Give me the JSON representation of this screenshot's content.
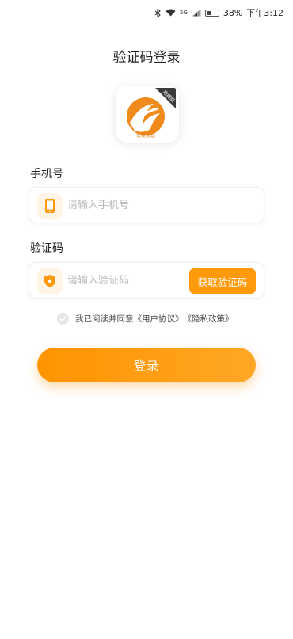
{
  "status_bar": {
    "battery": "38%",
    "time": "下午3:12",
    "network": "5G"
  },
  "page": {
    "title": "验证码登录"
  },
  "logo": {
    "badge_text": "跑腿版",
    "caption": "优易急送"
  },
  "phone": {
    "label": "手机号",
    "placeholder": "请输入手机号",
    "icon": "phone-icon"
  },
  "code": {
    "label": "验证码",
    "placeholder": "请输入验证码",
    "icon": "shield-icon",
    "button": "获取验证码"
  },
  "agreement": {
    "prefix": "我已阅读并同意",
    "user_agreement": "《用户协议》",
    "privacy_policy": "《隐私政策》"
  },
  "login_button": "登录",
  "colors": {
    "accent": "#ff9a0d",
    "accent_light": "#fff4e6"
  }
}
